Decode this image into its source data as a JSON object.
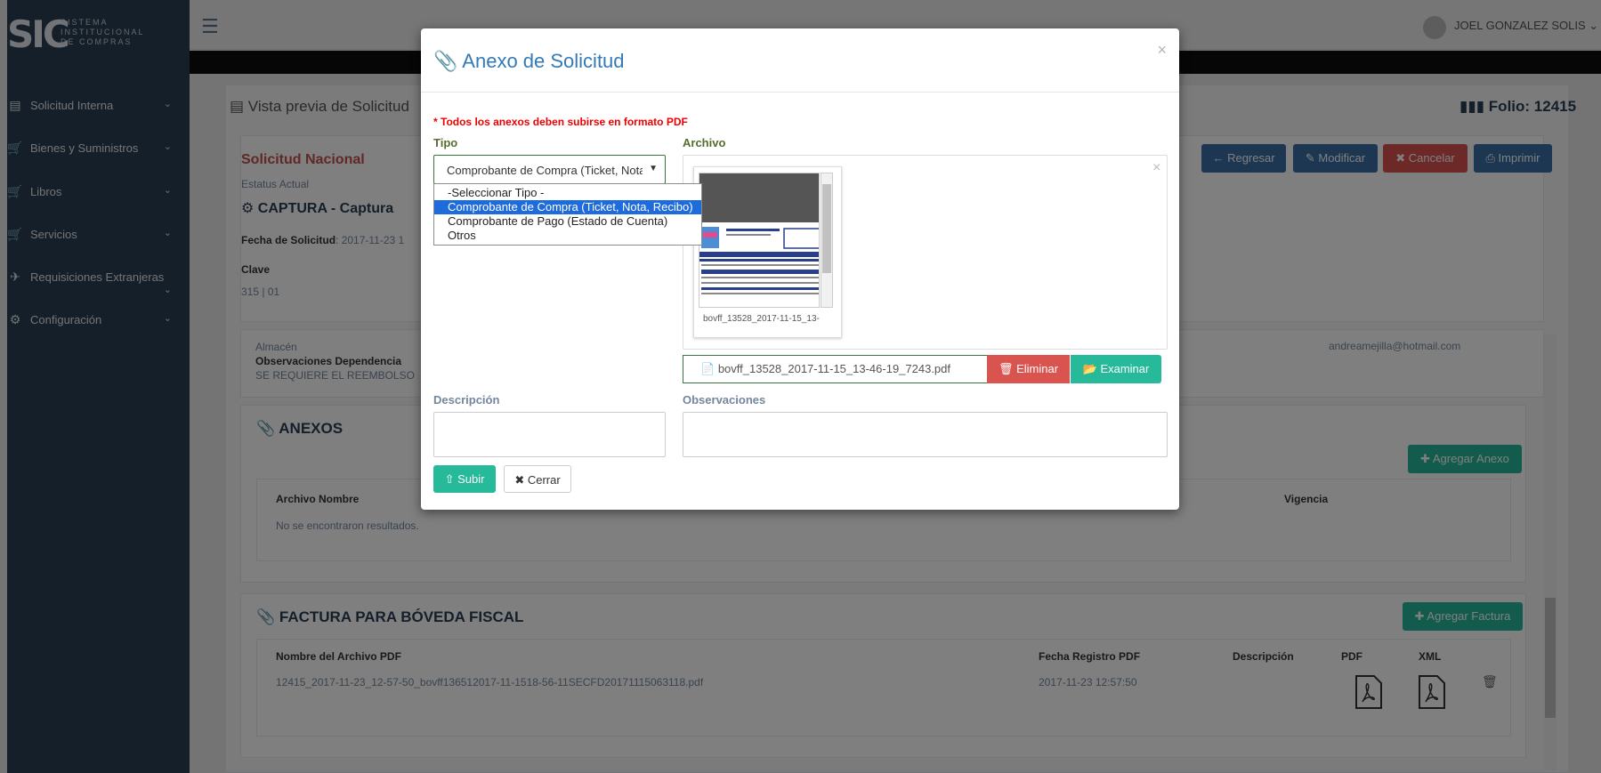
{
  "sidebar": {
    "logo_big": "SIC",
    "logo_lines": [
      "SISTEMA",
      "INSTITUCIONAL",
      "DE COMPRAS"
    ],
    "items": [
      {
        "label": "Solicitud Interna"
      },
      {
        "label": "Bienes y Suministros"
      },
      {
        "label": "Libros"
      },
      {
        "label": "Servicios"
      },
      {
        "label": "Requisiciones Extranjeras"
      },
      {
        "label": "Configuración"
      }
    ]
  },
  "topbar": {
    "user_name": "JOEL GONZALEZ SOLIS"
  },
  "page": {
    "preview_title": "Vista previa de Solicitud",
    "folio": "Folio: 12415",
    "request_type": "Solicitud Nacional",
    "status_label": "Estatus Actual",
    "status_value": "CAPTURA - Captura",
    "date_label": "Fecha de Solicitud",
    "date_value": ": 2017-11-23 1",
    "clave_label": "Clave",
    "clave_value": "315 | 01",
    "buttons": {
      "regresar": "Regresar",
      "modificar": "Modificar",
      "cancelar": "Cancelar",
      "imprimir": "Imprimir"
    },
    "almacen_label": "Almacén",
    "observaciones_label": "Observaciones Dependencia",
    "observaciones_value": "SE REQUIERE EL REEMBOLSO",
    "email": "andreamejilla@hotmail.com",
    "anexos": {
      "title": "ANEXOS",
      "add_button": "Agregar Anexo",
      "col_nombre": "Archivo Nombre",
      "col_vigencia": "Vigencia",
      "empty": "No se encontraron resultados."
    },
    "factura": {
      "title": "FACTURA PARA BÓVEDA FISCAL",
      "add_button": "Agregar Factura",
      "col_nombre": "Nombre del Archivo PDF",
      "col_fecha": "Fecha Registro PDF",
      "col_desc": "Descripción",
      "col_pdf": "PDF",
      "col_xml": "XML",
      "row_name": "12415_2017-11-23_12-57-50_bovff136512017-11-1518-56-11SECFD20171115063118.pdf",
      "row_date": "2017-11-23 12:57:50"
    }
  },
  "modal": {
    "title": "Anexo de Solicitud",
    "close": "×",
    "warning": "* Todos los anexos deben subirse en formato PDF",
    "tipo_label": "Tipo",
    "archivo_label": "Archivo",
    "tipo_selected": "Comprobante de Compra (Ticket, Nota, Recibo)",
    "tipo_options": [
      "-Seleccionar Tipo -",
      "Comprobante de Compra (Ticket, Nota, Recibo)",
      "Comprobante de Pago (Estado de Cuenta)",
      "Otros"
    ],
    "thumb_caption": "bovff_13528_2017-11-15_13-",
    "file_name": "bovff_13528_2017-11-15_13-46-19_7243.pdf",
    "eliminar": "Eliminar",
    "examinar": "Examinar",
    "descripcion_label": "Descripción",
    "observaciones_label": "Observaciones",
    "subir": "Subir",
    "cerrar": "Cerrar"
  }
}
